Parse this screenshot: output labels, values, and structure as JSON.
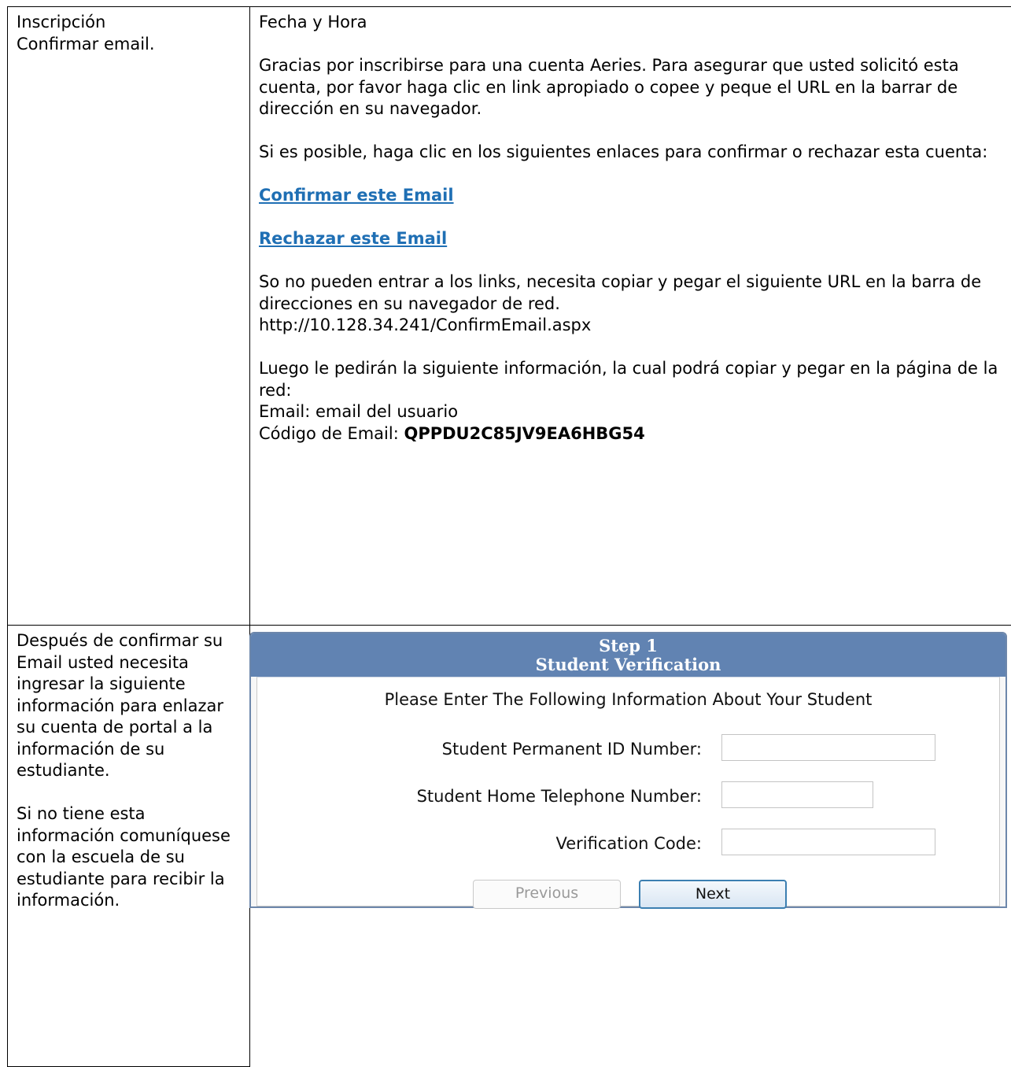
{
  "row1": {
    "left_title": "Inscripción",
    "left_subtitle": "Confirmar email.",
    "date_label": "Fecha y Hora",
    "thanks_paragraph": "Gracias por inscribirse para una cuenta  Aeries. Para asegurar que usted solicitó esta cuenta, por favor haga  clic en link apropiado o copee  y peque el URL en la barrar de dirección en su navegador.",
    "if_possible_paragraph": "Si es posible, haga clic en los siguientes enlaces para confirmar o rechazar esta cuenta:",
    "confirm_link": "Confirmar este Email",
    "reject_link": "Rechazar este Email",
    "cannot_enter_paragraph": "So no pueden entrar a los links, necesita copiar y pegar el siguiente URL en la barra de direcciones en su navegador de red.",
    "url": "http://10.128.34.241/ConfirmEmail.aspx",
    "then_paragraph": "Luego le pedirán la siguiente información, la cual podrá copiar y pegar en la página de la red:",
    "email_line": "Email: email del usuario",
    "code_label": "Código de Email: ",
    "code_value": "QPPDU2C85JV9EA6HBG54"
  },
  "row2": {
    "instructions": "Después de confirmar su Email usted necesita ingresar la siguiente información para enlazar su cuenta de portal a la información de su estudiante.",
    "contact_note": "Si no tiene esta información comuníquese con la escuela de su estudiante para recibir la información."
  },
  "form": {
    "step": "Step 1",
    "title": "Student Verification",
    "intro": "Please Enter The Following Information About Your Student",
    "fields": [
      {
        "label": "Student Permanent ID Number:",
        "value": ""
      },
      {
        "label": "Student Home Telephone Number:",
        "value": ""
      },
      {
        "label": "Verification Code:",
        "value": ""
      }
    ],
    "previous_label": "Previous",
    "next_label": "Next"
  },
  "colors": {
    "link": "#1f6fb4",
    "form_header": "#6183b2",
    "form_border": "#6d87ab",
    "next_border": "#3c7fb1"
  }
}
